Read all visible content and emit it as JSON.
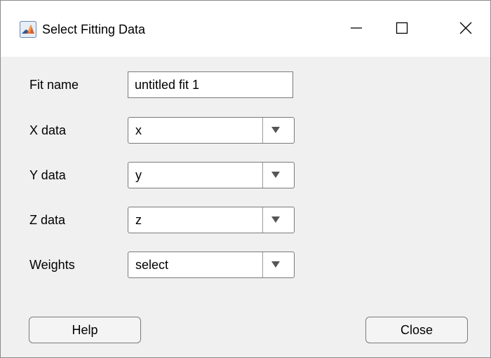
{
  "window": {
    "title": "Select Fitting Data",
    "app_icon": "matlab-membrane-icon",
    "controls": [
      "minimize-icon",
      "maximize-icon",
      "close-icon"
    ]
  },
  "form": {
    "fit_name": {
      "label": "Fit name",
      "value": "untitled fit 1"
    },
    "x_data": {
      "label": "X data",
      "value": "x"
    },
    "y_data": {
      "label": "Y data",
      "value": "y"
    },
    "z_data": {
      "label": "Z data",
      "value": "z"
    },
    "weights": {
      "label": "Weights",
      "value": "select"
    }
  },
  "buttons": {
    "help": "Help",
    "close": "Close"
  },
  "colors": {
    "dialog_bg": "#f0f0f0",
    "titlebar_bg": "#ffffff",
    "border": "#7a7a7a",
    "icon_orange": "#d9632b",
    "icon_blue": "#2c5aa0"
  }
}
